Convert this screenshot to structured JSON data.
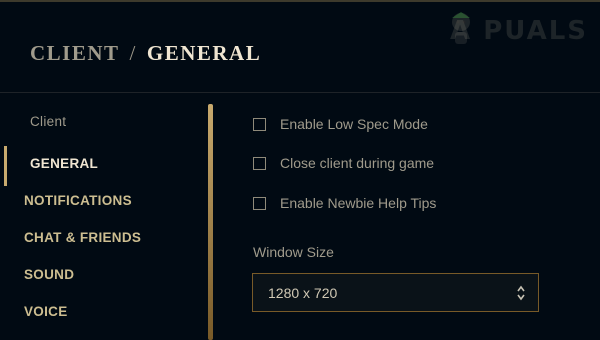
{
  "header": {
    "parent": "CLIENT",
    "separator": "/",
    "current": "GENERAL"
  },
  "watermark": {
    "text": "A  PUALS"
  },
  "sidebar": {
    "section_label": "Client",
    "items": [
      {
        "label": "GENERAL",
        "active": true
      },
      {
        "label": "NOTIFICATIONS"
      },
      {
        "label": "CHAT & FRIENDS"
      },
      {
        "label": "SOUND"
      },
      {
        "label": "VOICE"
      }
    ]
  },
  "options": [
    {
      "label": "Enable Low Spec Mode",
      "checked": false
    },
    {
      "label": "Close client during game",
      "checked": false
    },
    {
      "label": "Enable Newbie Help Tips",
      "checked": false
    }
  ],
  "window_size": {
    "label": "Window Size",
    "value": "1280 x 720"
  },
  "colors": {
    "background": "#010a13",
    "gold": "#c8aa6e",
    "text": "#a09b8c",
    "heading": "#f0e6d2"
  }
}
